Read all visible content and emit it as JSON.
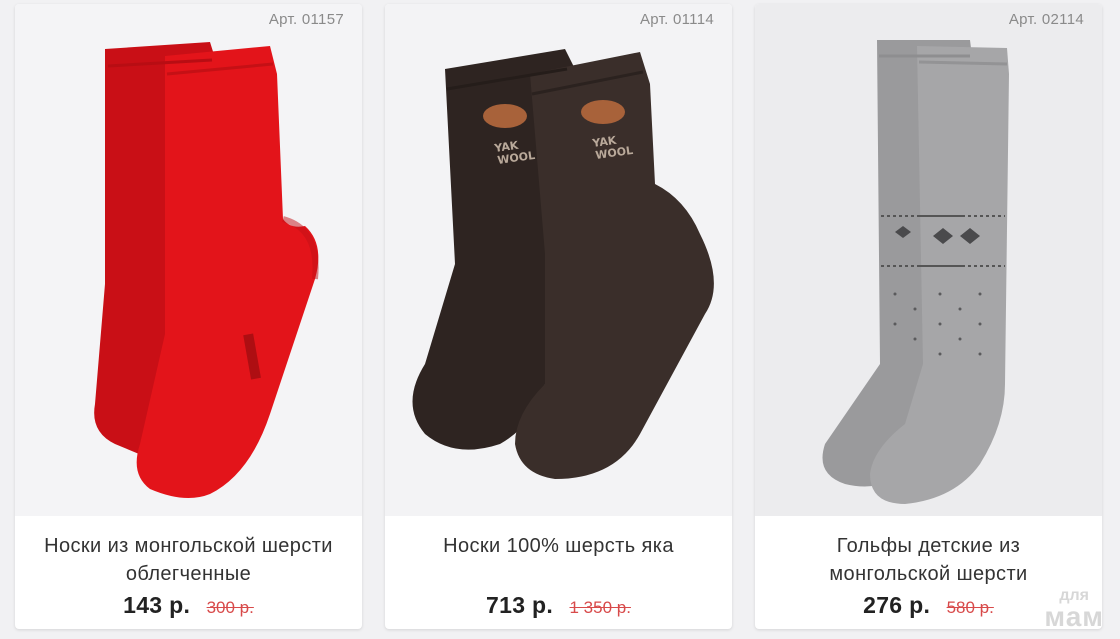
{
  "products": [
    {
      "sku": "Арт. 01157",
      "title": "Носки из монгольской шерсти облегченные",
      "price": "143 р.",
      "old_price": "300 р.",
      "sock_color": "#e3141a"
    },
    {
      "sku": "Арт. 01114",
      "title": "Носки 100% шерсть яка",
      "price": "713 р.",
      "old_price": "1 350 р.",
      "sock_color": "#3a2e2a",
      "knit_text": "YAK WOOL"
    },
    {
      "sku": "Арт. 02114",
      "title": "Гольфы детские из монгольской шерсти",
      "price": "276 р.",
      "old_price": "580 р.",
      "sock_color": "#a6a6a8"
    }
  ],
  "watermark": {
    "top": "для",
    "bottom": "мам"
  },
  "colors": {
    "page_bg": "#f1f1f3",
    "old_price": "#d84a4a",
    "price": "#222222"
  }
}
